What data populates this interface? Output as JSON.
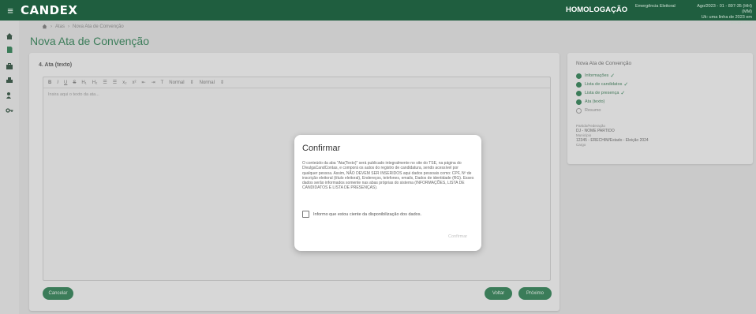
{
  "header": {
    "logo": "CANDEX",
    "environment": "HOMOLOGAÇÃO",
    "user_line1": "Emergência Eleitoral",
    "user_line2": "",
    "session_line1": "Ago/2023 - 01 - 897-35 (HH)(MM)",
    "session_line2": "Uk: uma linha de 2023 em andamento"
  },
  "breadcrumb": {
    "items": [
      "Atas",
      "Nova Ata de Convenção"
    ]
  },
  "page_title": "Nova Ata de Convenção",
  "section": {
    "title": "4. Ata (texto)"
  },
  "editor": {
    "toolbar": [
      "B",
      "I",
      "U",
      "S",
      "H₁",
      "H₂",
      "☰",
      "☰",
      "x₂",
      "x²",
      "⇤",
      "⇥",
      "T",
      "Normal",
      "⇕",
      "Normal",
      "⇕"
    ],
    "placeholder": "Insira aqui o texto da ata..."
  },
  "buttons": {
    "cancel": "Cancelar",
    "back": "Voltar",
    "next": "Próximo"
  },
  "right_panel": {
    "title": "Nova Ata de Convenção",
    "steps": [
      {
        "label": "Informações",
        "done": true
      },
      {
        "label": "Lista de candidatos",
        "done": true
      },
      {
        "label": "Lista de presença",
        "done": true
      },
      {
        "label": "Ata (texto)",
        "done": false,
        "current": true
      },
      {
        "label": "Resumo",
        "done": false
      }
    ],
    "info_label1": "Partido/Federação",
    "info_value1": "DJ - NOME PARTIDO",
    "info_label2": "Município",
    "info_value2": "12345 - ERECHIM/Estado - Eleição 2024",
    "info_label3": "Cargo"
  },
  "modal": {
    "title": "Confirmar",
    "body": "O conteúdo da aba \"Ata(Texto)\" será publicado integralmente no site do TSE, na página do DivulgaCandContas, e comporá os autos do registro de candidatura, sendo acessível por qualquer pessoa. Assim, NÃO DEVEM SER INSERIDOS aqui dados pessoais como: CPF, Nº de inscrição eleitoral (título eleitoral), Endereços, telefones, emails, Dados de identidade (RG). Esses dados serão informados somente nas abas próprias do sistema (INFORMAÇÕES, LISTA DE CANDIDATOS E LISTA DE PRESENÇAS).",
    "checkbox_label": "Informo que estou ciente da disponibilização dos dados.",
    "confirm_label": "Confirmar"
  },
  "colors": {
    "primary": "#2e7d52",
    "topbar": "#1f5e3f",
    "background": "#dcdcdc"
  }
}
